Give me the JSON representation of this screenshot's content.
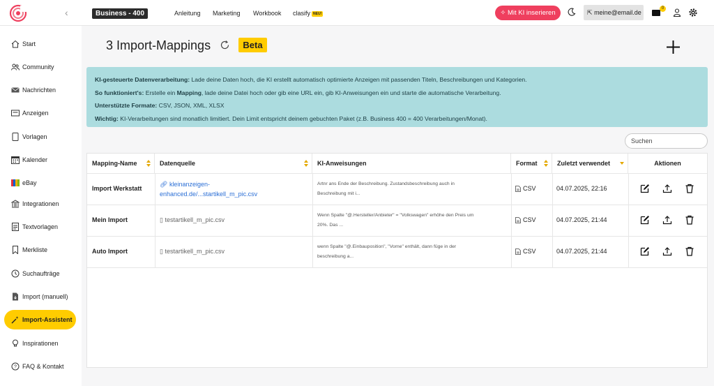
{
  "header": {
    "plan": "Business - 400",
    "nav": [
      "Anleitung",
      "Marketing",
      "Workbook",
      "clasify"
    ],
    "new_badge": "NEU!",
    "ki_button": "Mit KI inserieren",
    "email": "meine@email.de",
    "mail_count": "0"
  },
  "sidebar": {
    "items": [
      {
        "label": "Start",
        "icon": "home-icon"
      },
      {
        "label": "Community",
        "icon": "users-icon"
      },
      {
        "label": "Nachrichten",
        "icon": "mail-icon"
      },
      {
        "label": "Anzeigen",
        "icon": "ads-icon"
      },
      {
        "label": "Vorlagen",
        "icon": "template-icon"
      },
      {
        "label": "Kalender",
        "icon": "calendar-icon"
      },
      {
        "label": "eBay",
        "icon": "ebay-icon"
      },
      {
        "label": "Integrationen",
        "icon": "integration-icon"
      },
      {
        "label": "Textvorlagen",
        "icon": "text-template-icon"
      },
      {
        "label": "Merkliste",
        "icon": "bookmark-icon"
      },
      {
        "label": "Suchaufträge",
        "icon": "clock-icon"
      },
      {
        "label": "Import (manuell)",
        "icon": "import-file-icon"
      },
      {
        "label": "Import-Assistent",
        "icon": "magic-wand-icon",
        "active": true
      },
      {
        "label": "Inspirationen",
        "icon": "lightbulb-icon"
      },
      {
        "label": "FAQ & Kontakt",
        "icon": "help-icon"
      }
    ]
  },
  "main": {
    "title": "3 Import-Mappings",
    "badge": "Beta",
    "info": [
      {
        "bold": "KI-gesteuerte Datenverarbeitung:",
        "text": " Lade deine Daten hoch, die KI erstellt automatisch optimierte Anzeigen mit passenden Titeln, Beschreibungen und Kategorien."
      },
      {
        "bold": "So funktioniert's:",
        "text": " Erstelle ein ",
        "bold2": "Mapping",
        "text2": ", lade deine Datei hoch oder gib eine URL ein, gib KI-Anweisungen ein und starte die automatische Verarbeitung."
      },
      {
        "bold": "Unterstützte Formate:",
        "text": " CSV, JSON, XML, XLSX"
      },
      {
        "bold": "Wichtig:",
        "text": " KI-Verarbeitungen sind monatlich limitiert. Dein Limit entspricht deinem gebuchten Paket (z.B. Business 400 = 400 Verarbeitungen/Monat)."
      }
    ],
    "search_placeholder": "Suchen"
  },
  "table": {
    "columns": [
      "Mapping-Name",
      "Datenquelle",
      "KI-Anweisungen",
      "Format",
      "Zuletzt verwendet",
      "Aktionen"
    ],
    "rows": [
      {
        "name": "Import Werkstatt",
        "source_type": "link",
        "source": [
          "kleinanzeigen-",
          "enhanced.de/...startikell_m_pic.csv"
        ],
        "instructions": [
          "Artnr ans Ende der Beschreibung. Zustandsbeschreibung auch in",
          "Beschreibung mit i..."
        ],
        "format": "CSV",
        "last_used": "04.07.2025, 22:16"
      },
      {
        "name": "Mein Import",
        "source_type": "file",
        "source": [
          "testartikell_m_pic.csv"
        ],
        "instructions": [
          "Wenn Spalte \"@.Hersteller/Anbieter\" = \"Volkswagen\" erhöhe den Preis um",
          "20%. Das ..."
        ],
        "format": "CSV",
        "last_used": "04.07.2025, 21:44"
      },
      {
        "name": "Auto Import",
        "source_type": "file",
        "source": [
          "testartikell_m_pic.csv"
        ],
        "instructions": [
          "wenn Spalte \"@.Einbauposition\", \"Vorne\" enthält, dann füge in der",
          "beschreibung a..."
        ],
        "format": "CSV",
        "last_used": "04.07.2025, 21:44"
      }
    ]
  },
  "colors": {
    "accent": "#ffcc00",
    "ki_button": "#ef3f5e",
    "info_bg": "#acdcdf",
    "link": "#2b6fd6"
  }
}
